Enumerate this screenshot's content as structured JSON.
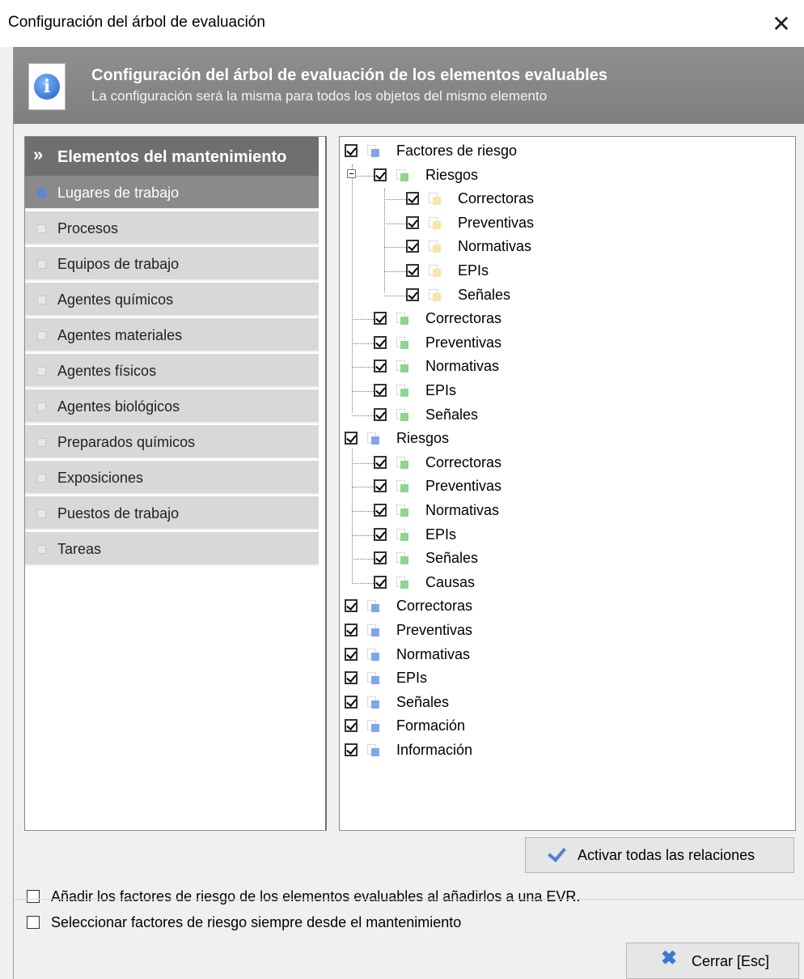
{
  "window": {
    "title": "Configuración del árbol de evaluación",
    "close_glyph": "✕"
  },
  "header": {
    "title": "Configuración del árbol de evaluación de los elementos evaluables",
    "subtitle": "La configuración será la misma para todos los objetos del mismo elemento",
    "icon": "info-icon"
  },
  "left_panel": {
    "header": "Elementos del mantenimiento",
    "chevron": "»",
    "items": [
      {
        "label": "Lugares de trabajo",
        "active": true
      },
      {
        "label": "Procesos",
        "active": false
      },
      {
        "label": "Equipos de trabajo",
        "active": false
      },
      {
        "label": "Agentes químicos",
        "active": false
      },
      {
        "label": "Agentes materiales",
        "active": false
      },
      {
        "label": "Agentes físicos",
        "active": false
      },
      {
        "label": "Agentes biológicos",
        "active": false
      },
      {
        "label": "Preparados químicos",
        "active": false
      },
      {
        "label": "Exposiciones",
        "active": false
      },
      {
        "label": "Puestos de trabajo",
        "active": false
      },
      {
        "label": "Tareas",
        "active": false
      }
    ]
  },
  "tree": [
    {
      "label": "Factores de riesgo",
      "level": 0,
      "color": "blue",
      "checked": true
    },
    {
      "label": "Riesgos",
      "level": 1,
      "color": "green",
      "checked": true,
      "expanded": true
    },
    {
      "label": "Correctoras",
      "level": 2,
      "color": "yellow",
      "checked": true
    },
    {
      "label": "Preventivas",
      "level": 2,
      "color": "yellow",
      "checked": true
    },
    {
      "label": "Normativas",
      "level": 2,
      "color": "yellow",
      "checked": true
    },
    {
      "label": "EPIs",
      "level": 2,
      "color": "yellow",
      "checked": true
    },
    {
      "label": "Señales",
      "level": 2,
      "color": "yellow",
      "checked": true
    },
    {
      "label": "Correctoras",
      "level": 1,
      "color": "green",
      "checked": true
    },
    {
      "label": "Preventivas",
      "level": 1,
      "color": "green",
      "checked": true
    },
    {
      "label": "Normativas",
      "level": 1,
      "color": "green",
      "checked": true
    },
    {
      "label": "EPIs",
      "level": 1,
      "color": "green",
      "checked": true
    },
    {
      "label": "Señales",
      "level": 1,
      "color": "green",
      "checked": true
    },
    {
      "label": "Riesgos",
      "level": 0,
      "color": "blue",
      "checked": true
    },
    {
      "label": "Correctoras",
      "level": 1,
      "color": "green",
      "checked": true
    },
    {
      "label": "Preventivas",
      "level": 1,
      "color": "green",
      "checked": true
    },
    {
      "label": "Normativas",
      "level": 1,
      "color": "green",
      "checked": true
    },
    {
      "label": "EPIs",
      "level": 1,
      "color": "green",
      "checked": true
    },
    {
      "label": "Señales",
      "level": 1,
      "color": "green",
      "checked": true
    },
    {
      "label": "Causas",
      "level": 1,
      "color": "green",
      "checked": true
    },
    {
      "label": "Correctoras",
      "level": 0,
      "color": "blue",
      "checked": true
    },
    {
      "label": "Preventivas",
      "level": 0,
      "color": "blue",
      "checked": true
    },
    {
      "label": "Normativas",
      "level": 0,
      "color": "blue",
      "checked": true
    },
    {
      "label": "EPIs",
      "level": 0,
      "color": "blue",
      "checked": true
    },
    {
      "label": "Señales",
      "level": 0,
      "color": "blue",
      "checked": true
    },
    {
      "label": "Formación",
      "level": 0,
      "color": "blue",
      "checked": true
    },
    {
      "label": "Información",
      "level": 0,
      "color": "blue",
      "checked": true
    }
  ],
  "buttons": {
    "activate_all": "Activar todas las relaciones",
    "close": "Cerrar [Esc]"
  },
  "options": [
    {
      "label": "Añadir los factores de riesgo de los elementos evaluables al añadirlos a una EVR.",
      "checked": false
    },
    {
      "label": "Seleccionar factores de riesgo siempre desde el mantenimiento",
      "checked": false
    }
  ]
}
